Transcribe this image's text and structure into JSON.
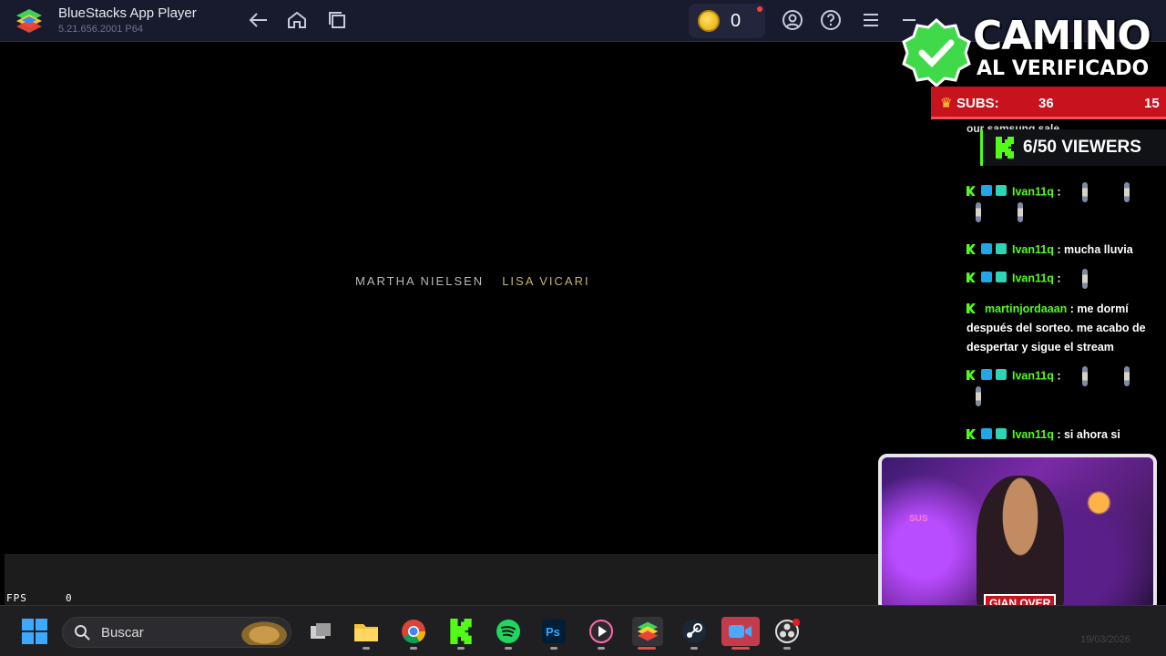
{
  "window": {
    "title": "BlueStacks App Player",
    "version": "5.21.656.2001 P64",
    "coins": "0"
  },
  "video": {
    "credit_1": "MARTHA NIELSEN",
    "credit_2": "LISA VICARI",
    "fps_label": "FPS",
    "fps_value": "0"
  },
  "overlay": {
    "title_line1": "CAMINO",
    "title_line2": "AL VERIFICADO",
    "subs_label": "SUBS:",
    "subs_count": "36",
    "subs_goal": "15",
    "viewers": "6/50 VIEWERS",
    "streamer_tag": "GIAN OVER",
    "room_sign": "SUS"
  },
  "chat": {
    "partial_line": "our samsung sale",
    "messages": [
      {
        "user": "Ivan11q",
        "text": ""
      },
      {
        "user": "Ivan11q",
        "text": "mucha lluvia"
      },
      {
        "user": "Ivan11q",
        "text": ""
      },
      {
        "user": "martinjordaaan",
        "text": "me dormí después del sorteo. me acabo de despertar y sigue el stream"
      },
      {
        "user": "Ivan11q",
        "text": ""
      },
      {
        "user": "Ivan11q",
        "text": "si ahora si"
      }
    ]
  },
  "taskbar": {
    "search_placeholder": "Buscar",
    "date": "19/03/2026",
    "apps": [
      "task-view",
      "file-explorer",
      "chrome",
      "kick",
      "spotify",
      "photoshop",
      "media-player",
      "bluestacks",
      "steam",
      "zoom",
      "obs"
    ]
  },
  "colors": {
    "kick_green": "#53fc18",
    "subs_red": "#c8131e",
    "titlebar": "#181a2e"
  }
}
